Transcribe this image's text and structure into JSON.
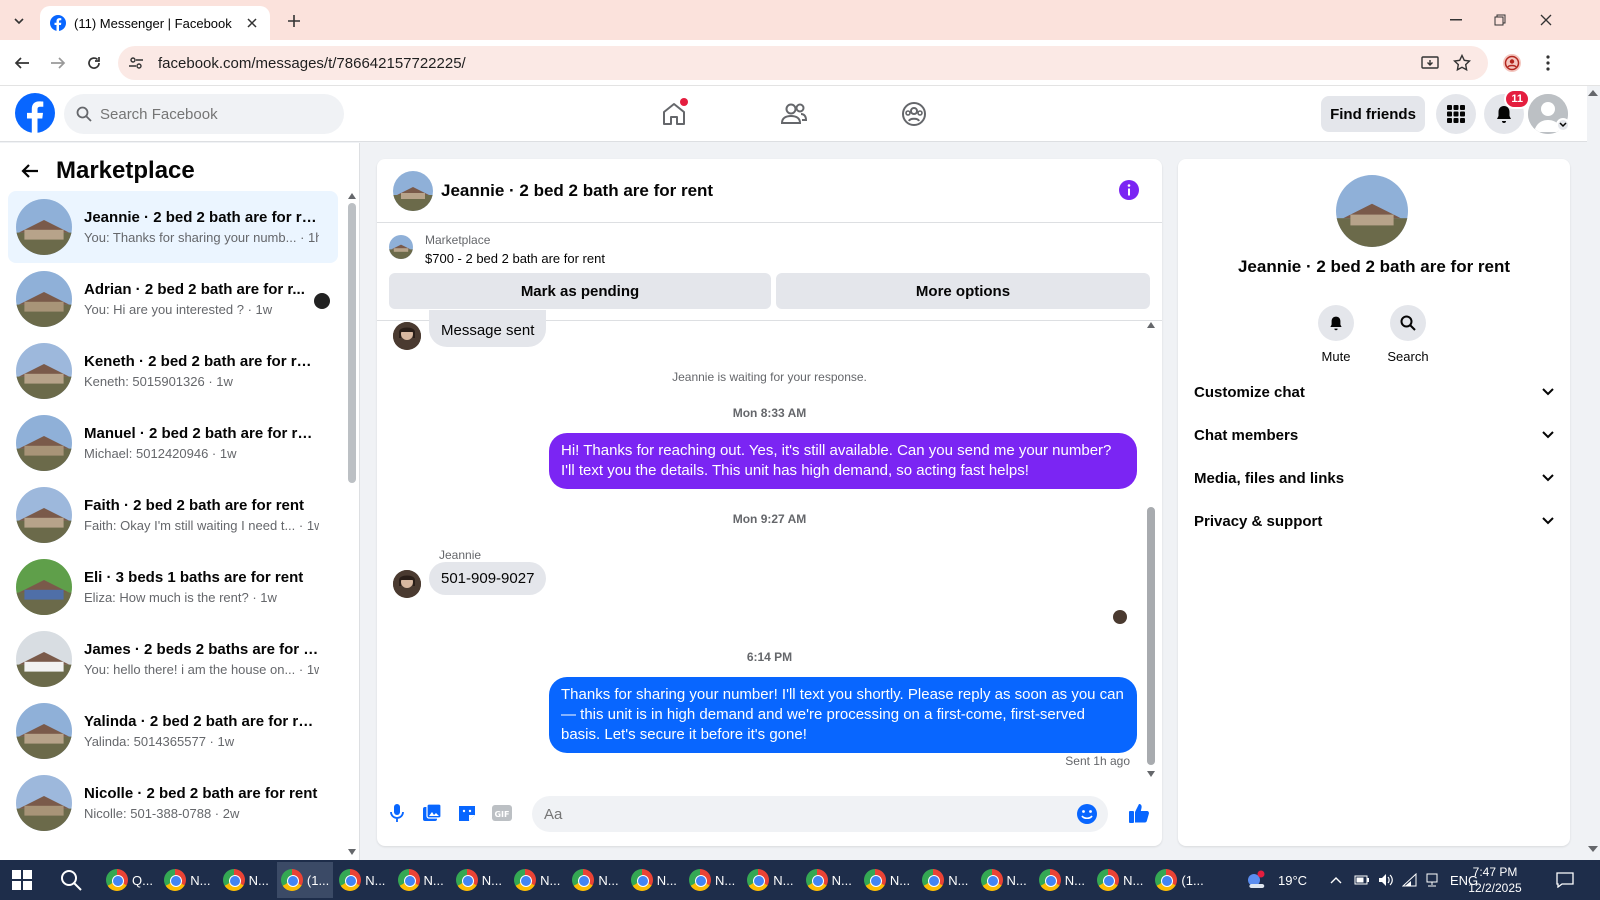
{
  "browser": {
    "tab_title": "(11) Messenger | Facebook",
    "url": "facebook.com/messages/t/786642157722225/"
  },
  "fb": {
    "search_placeholder": "Search Facebook",
    "find_friends": "Find friends",
    "notification_count": "11"
  },
  "left": {
    "title": "Marketplace",
    "conversations": [
      {
        "name": "Jeannie · 2 bed 2 bath are for rent",
        "preview": "You: Thanks for sharing your numb... · 1h",
        "active": true
      },
      {
        "name": "Adrian · 2 bed 2 bath are for r...",
        "preview": "You: Hi are you interested ? · 1w"
      },
      {
        "name": "Keneth · 2 bed 2 bath are for rent",
        "preview": "Keneth: 5015901326 · 1w"
      },
      {
        "name": "Manuel · 2 bed 2 bath are for rent",
        "preview": "Michael: 5012420946 · 1w"
      },
      {
        "name": "Faith · 2 bed 2 bath are for rent",
        "preview": "Faith: Okay I'm still waiting I need t... · 1w"
      },
      {
        "name": "Eli · 3 beds 1 baths are for rent",
        "preview": "Eliza: How much is the rent? · 1w"
      },
      {
        "name": "James · 2 beds 2 baths are for re...",
        "preview": "You: hello there! i am the house on... · 1w"
      },
      {
        "name": "Yalinda · 2 bed 2 bath are for rent",
        "preview": "Yalinda: 5014365577 · 1w"
      },
      {
        "name": "Nicolle · 2 bed 2 bath are for rent",
        "preview": "Nicolle: 501-388-0788 · 2w"
      }
    ]
  },
  "chat": {
    "header_name": "Jeannie · 2 bed 2 bath are for rent",
    "marketplace_label": "Marketplace",
    "listing": "$700 - 2 bed 2 bath are for rent",
    "mark_pending": "Mark as pending",
    "more_options": "More options",
    "msg_sent": "Message sent",
    "waiting": "Jeannie is waiting for your response.",
    "ts1": "Mon 8:33 AM",
    "out1": "Hi! Thanks for reaching out. Yes, it's still available. Can you send me your number? I'll text you the details. This unit has high demand, so acting fast helps!",
    "ts2": "Mon 9:27 AM",
    "sender": "Jeannie",
    "in1": "501-909-9027",
    "ts3": "6:14 PM",
    "out2": "Thanks for sharing your number! I'll text you shortly. Please reply as soon as you can — this unit is in high demand and we're processing on a first-come, first-served basis. Let's secure it before it's gone!",
    "sent_status": "Sent 1h ago",
    "composer_placeholder": "Aa"
  },
  "right": {
    "name": "Jeannie · 2 bed 2 bath are for rent",
    "mute": "Mute",
    "search": "Search",
    "sections": [
      "Customize chat",
      "Chat members",
      "Media, files and links",
      "Privacy & support"
    ]
  },
  "taskbar": {
    "items": [
      "Q...",
      "N...",
      "N...",
      "(1...",
      "N...",
      "N...",
      "N...",
      "N...",
      "N...",
      "N...",
      "N...",
      "N...",
      "N...",
      "N...",
      "N...",
      "N...",
      "N...",
      "N...",
      "(1..."
    ],
    "temp": "19°C",
    "lang": "ENG",
    "time": "7:47 PM",
    "date": "12/2/2025"
  },
  "colors": {
    "fb_blue": "#0866ff",
    "purple_bubble": "#7b25f3",
    "notif_red": "#e41e3f"
  }
}
